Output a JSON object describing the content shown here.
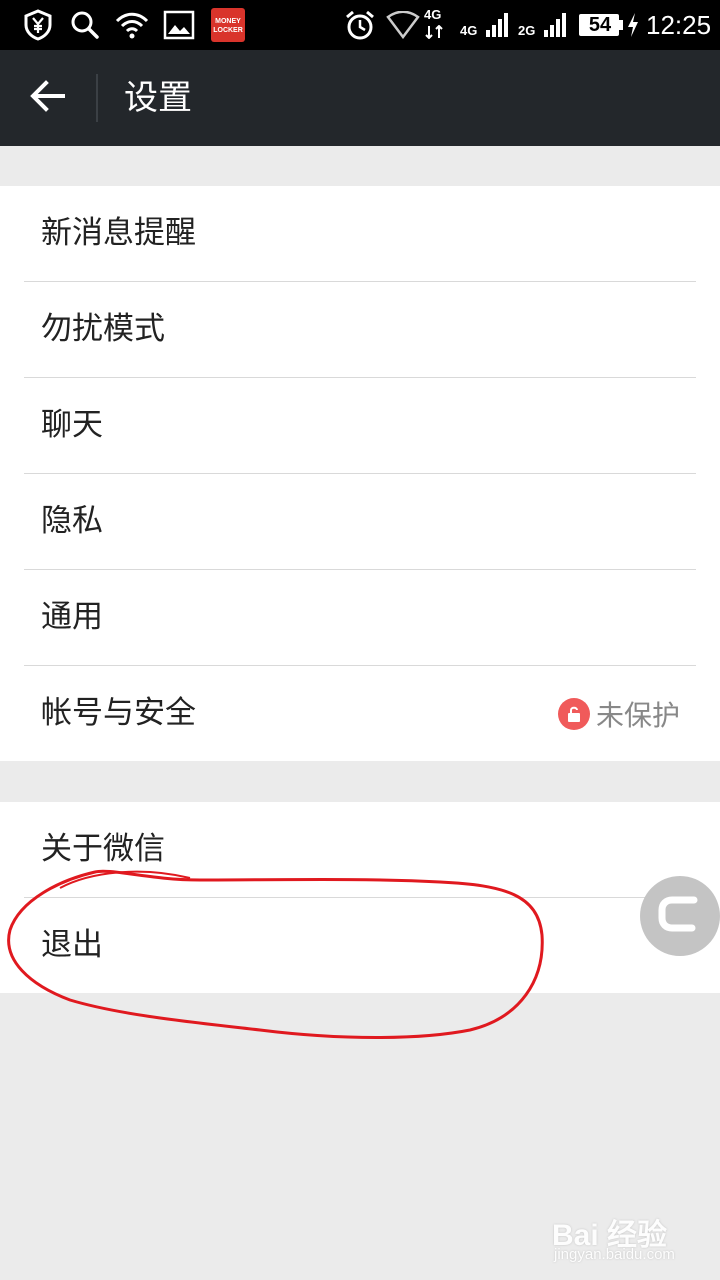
{
  "status_bar": {
    "app_badge_text": "MONEY LOCKER",
    "net_4g_top": "4G",
    "net_4g": "4G",
    "net_2g": "2G",
    "battery": "54",
    "time": "12:25",
    "icons": [
      "shield-yuan-icon",
      "search-icon",
      "wifi-icon",
      "gallery-icon",
      "money-locker-icon",
      "alarm-icon",
      "wifi-outline-icon",
      "signal-icon",
      "battery-icon",
      "charging-icon"
    ]
  },
  "header": {
    "back_icon": "arrow-left-icon",
    "title": "设置"
  },
  "settings": {
    "group1": [
      {
        "label": "新消息提醒"
      },
      {
        "label": "勿扰模式"
      },
      {
        "label": "聊天"
      },
      {
        "label": "隐私"
      },
      {
        "label": "通用"
      },
      {
        "label": "帐号与安全",
        "status": "未保护",
        "status_icon": "unlock-icon",
        "status_color": "#f05a5a"
      }
    ],
    "group2": [
      {
        "label": "关于微信"
      },
      {
        "label": "退出"
      }
    ]
  },
  "annotation": {
    "color": "#e0191f"
  },
  "floating_button": {
    "icon": "c-logo-icon"
  },
  "watermark": {
    "main": "Bai 经验",
    "sub": "jingyan.baidu.com"
  }
}
